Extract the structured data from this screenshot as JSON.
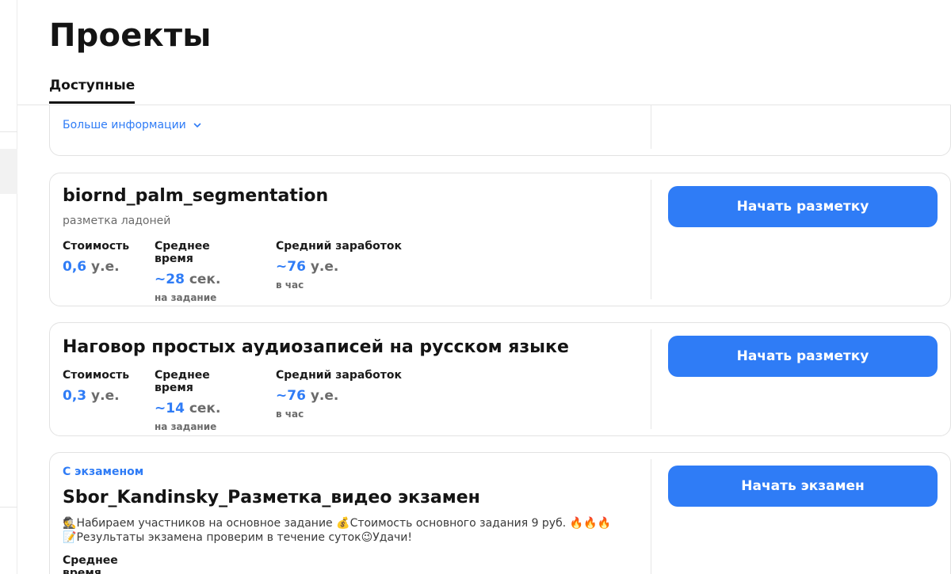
{
  "page": {
    "title": "Проекты"
  },
  "tabs": [
    {
      "label": "Доступные",
      "active": true
    }
  ],
  "colors": {
    "accent": "#2f7cf6",
    "text": "#141414",
    "muted": "#6b6b6b",
    "border": "#e2e2e2"
  },
  "projects": [
    {
      "more_info_label": "Больше информации"
    },
    {
      "title": "biornd_palm_segmentation",
      "subtitle": "разметка ладоней",
      "button_label": "Начать разметку",
      "stats": {
        "cost": {
          "label": "Стоимость",
          "value": "0,6",
          "unit": "у.е."
        },
        "avg_time": {
          "label": "Среднее время",
          "value": "~28",
          "unit": "сек.",
          "note": "на задание"
        },
        "avg_earnings": {
          "label": "Средний заработок",
          "value": "~76",
          "unit": "у.е.",
          "note": "в час"
        }
      }
    },
    {
      "title": "Наговор простых аудиозаписей на русском языке",
      "button_label": "Начать разметку",
      "stats": {
        "cost": {
          "label": "Стоимость",
          "value": "0,3",
          "unit": "у.е."
        },
        "avg_time": {
          "label": "Среднее время",
          "value": "~14",
          "unit": "сек.",
          "note": "на задание"
        },
        "avg_earnings": {
          "label": "Средний заработок",
          "value": "~76",
          "unit": "у.е.",
          "note": "в час"
        }
      }
    },
    {
      "badge": "С экзаменом",
      "title": "Sbor_Kandinsky_Разметка_видео экзамен",
      "button_label": "Начать экзамен",
      "description": {
        "line1_emoji_a": "🕵️",
        "line1_text_a": "Набираем участников на основное задание ",
        "line1_emoji_b": "💰",
        "line1_text_b": "Стоимость основного задания 9 руб. ",
        "line1_emoji_c": "🔥🔥🔥",
        "line2_emoji_a": "📝",
        "line2_text_a": "Результаты экзамена проверим в течение суток",
        "line2_emoji_b": "😉",
        "line2_text_b": "Удачи!"
      },
      "stats": {
        "avg_time": {
          "label": "Среднее время"
        }
      }
    }
  ]
}
